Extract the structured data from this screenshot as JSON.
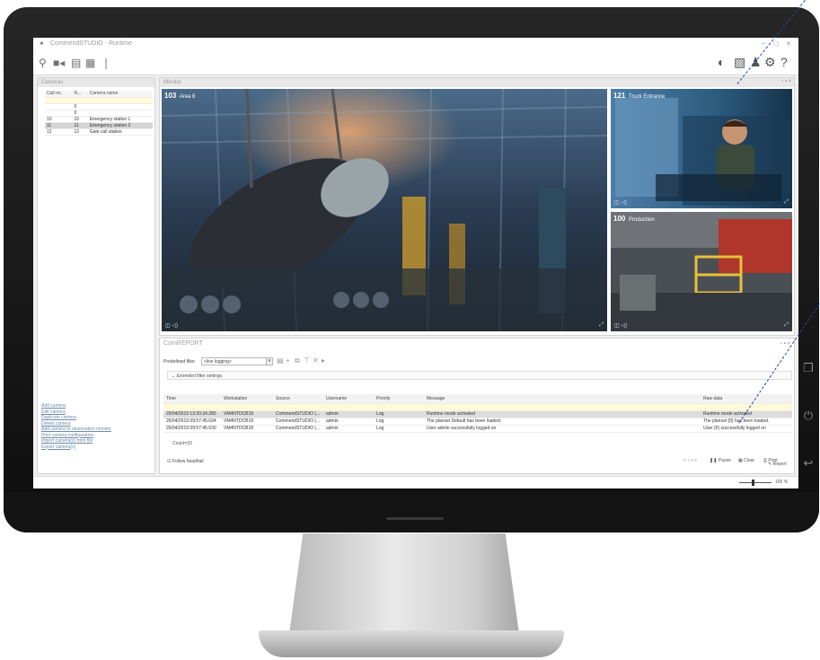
{
  "app": {
    "title": "CommendSTUDIO - Runtime"
  },
  "toolbar": {
    "left_icons": [
      "map-pin-icon",
      "video-camera-icon",
      "document-icon",
      "calendar-icon",
      "microphone-icon"
    ],
    "right_icons": [
      "toggle-icon",
      "image-icon",
      "user-icon",
      "gear-icon",
      "help-icon"
    ]
  },
  "cameras": {
    "title": "Cameras",
    "columns": [
      "Call no.",
      "N...",
      "Camera name"
    ],
    "rows": [
      {
        "call": "",
        "n": "",
        "name": ""
      },
      {
        "call": "",
        "n": "0",
        "name": ""
      },
      {
        "call": "",
        "n": "0",
        "name": ""
      },
      {
        "call": "10",
        "n": "10",
        "name": "Emergency station 1"
      },
      {
        "call": "11",
        "n": "11",
        "name": "Emergency station 2"
      },
      {
        "call": "12",
        "n": "12",
        "name": "Gate call station"
      }
    ],
    "links": [
      "Add camera",
      "Edit camera",
      "Duplicate camera",
      "Delete camera",
      "Add camera to observation monitor",
      "Print camera configuration",
      "Import camera(s) from file",
      "Export camera(s)"
    ]
  },
  "monitor": {
    "title": "Monitor",
    "videos": [
      {
        "number": "103",
        "name": "Area 8"
      },
      {
        "number": "121",
        "name": "Truck Entrance"
      },
      {
        "number": "100",
        "name": "Production"
      }
    ]
  },
  "report": {
    "title": "ComREPORT",
    "filter_label": "Predefined filter",
    "filter_value": "<live logging>",
    "extended_filter": "Extended filter settings",
    "columns": [
      "Time",
      "Workstation",
      "Source",
      "Username",
      "Priority",
      "Message",
      "Raw data"
    ],
    "rows": [
      {
        "time": "",
        "ws": "",
        "src": "",
        "user": "",
        "prio": "",
        "msg": "",
        "raw": ""
      },
      {
        "time": "26/04/2019 13:20:34.285",
        "ws": "VM4NTDCB18",
        "src": "CommendSTUDIO (...",
        "user": "admin",
        "prio": "Log",
        "msg": "Runtime mode activated",
        "raw": "Runtime mode activated"
      },
      {
        "time": "26/04/2019 09:57:45.634",
        "ws": "VM4NTDCB18",
        "src": "CommendSTUDIO (...",
        "user": "admin",
        "prio": "Log",
        "msg": "The planset Default has been loaded.",
        "raw": "The planset {0} has been loaded."
      },
      {
        "time": "26/04/2019 09:57:45.630",
        "ws": "VM4NTDCB18",
        "src": "CommendSTUDIO (...",
        "user": "admin",
        "prio": "Log",
        "msg": "User admin successfully logged on",
        "raw": "User {0} successfully logged on"
      }
    ],
    "count": "Count=33",
    "follow_tail": "Follow head/tail",
    "actions": [
      "Lock",
      "Pause",
      "Clear",
      "Print",
      "Report"
    ]
  },
  "statusbar": {
    "zoom": "100 %"
  }
}
